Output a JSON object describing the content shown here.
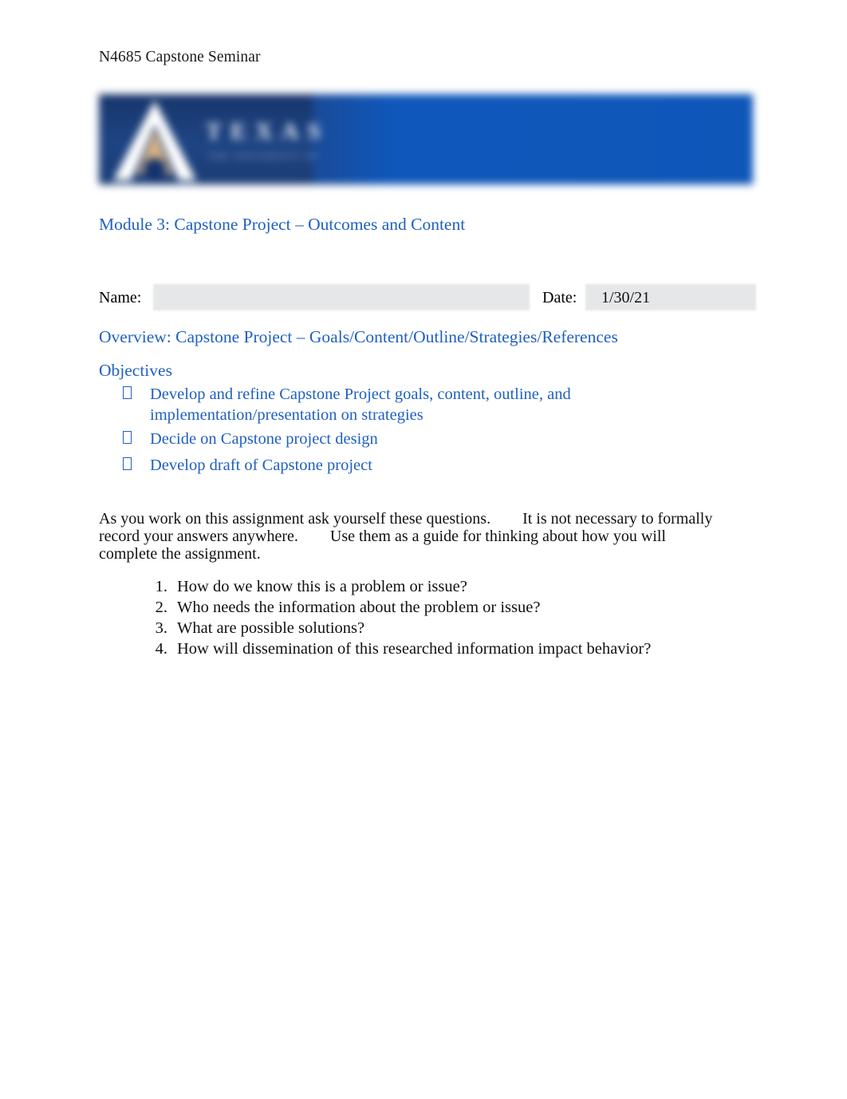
{
  "document": {
    "running_header": "N4685 Capstone Seminar",
    "title": "Module 3: Capstone Project – Outcomes and Content",
    "overview_heading": "Overview: Capstone Project – Goals/Content/Outline/Strategies/References",
    "objectives_heading": "Objectives"
  },
  "banner": {
    "logo_letter_mark": "A",
    "wordmark": "TEXAS",
    "subtext": "THE UNIVERSITY OF",
    "navy_color": "#1d3f76",
    "blue_color": "#0e56b8",
    "gold_color": "#d9b384"
  },
  "form": {
    "name_label": "Name:",
    "name_value": "",
    "name_placeholder": "",
    "date_label": "Date:",
    "date_value": "1/30/21"
  },
  "objectives": {
    "bullet_glyph": "missing-glyph-box",
    "items": [
      "Develop and refine Capstone Project goals, content, outline, and implementation/presentation on strategies",
      "Decide on Capstone project design",
      "Develop draft of Capstone project"
    ]
  },
  "body": {
    "paragraph": "As you work on this assignment ask yourself these questions.  It is not necessary to formally record your answers anywhere.  Use them as a guide for thinking about how you will complete the assignment."
  },
  "questions": {
    "items": [
      {
        "number": "1.",
        "text": "How do we know this is a problem or issue?"
      },
      {
        "number": "2.",
        "text": "Who needs the information about the problem or issue?"
      },
      {
        "number": "3.",
        "text": "What are possible solutions?"
      },
      {
        "number": "4.",
        "text": "How will dissemination of this researched information impact behavior?"
      }
    ]
  },
  "colors": {
    "heading_blue": "#2060c0",
    "form_field_gray": "#e6e7e8",
    "text_black": "#111111"
  }
}
